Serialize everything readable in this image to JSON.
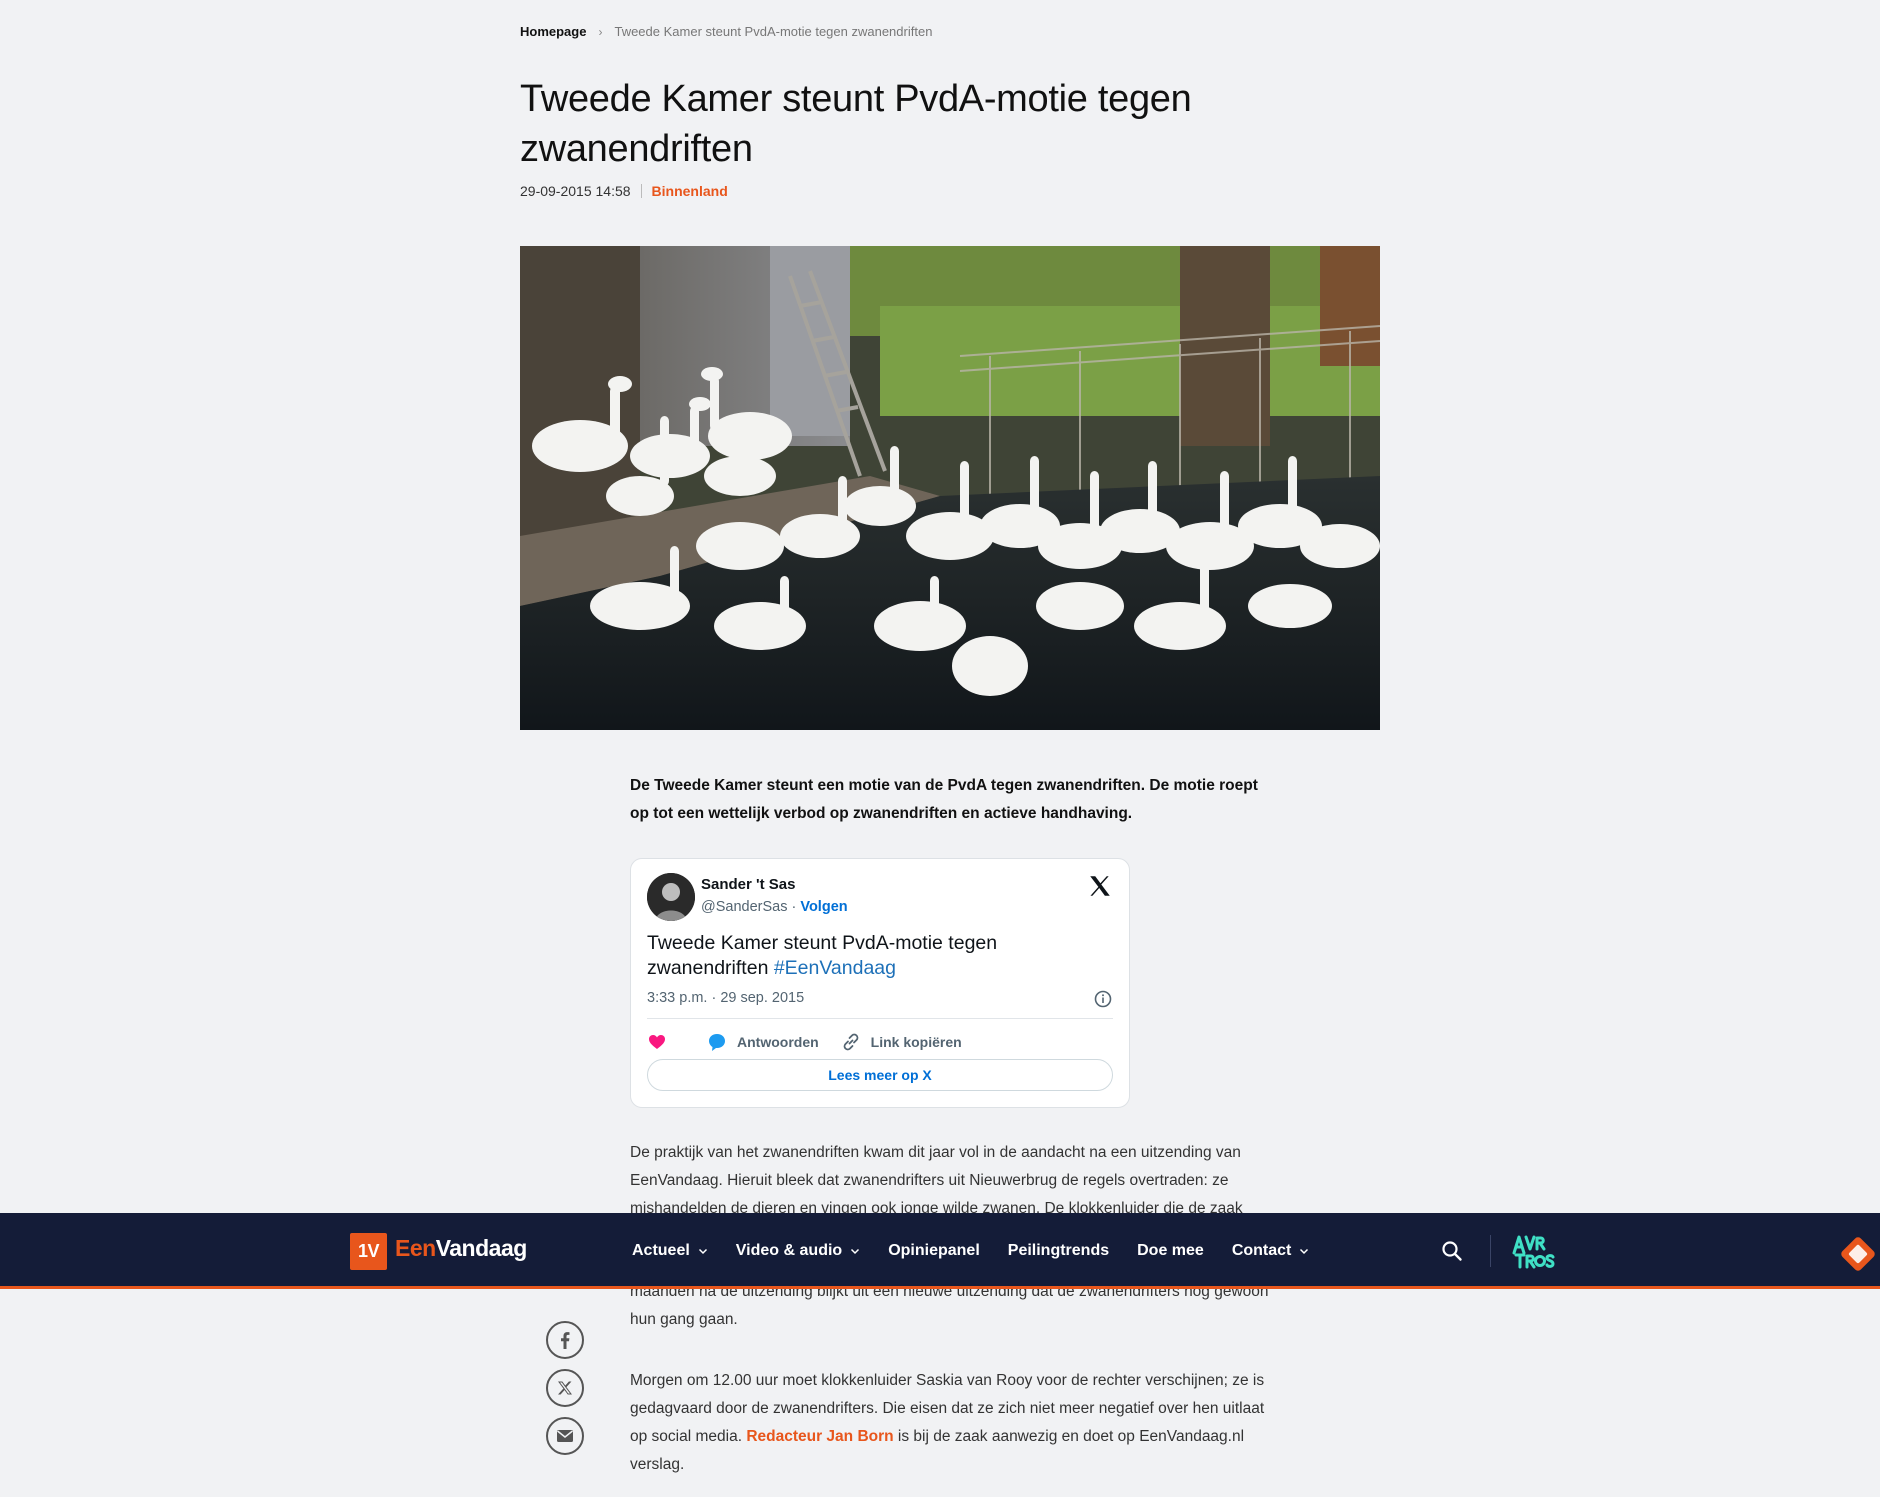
{
  "breadcrumb": {
    "home": "Homepage",
    "separator": "›",
    "current": "Tweede Kamer steunt PvdA-motie tegen zwanendriften"
  },
  "article": {
    "title": "Tweede Kamer steunt PvdA-motie tegen zwanendriften",
    "date": "29-09-2015 14:58",
    "category": "Binnenland",
    "lead": "De Tweede Kamer steunt een motie van de PvdA tegen zwanendriften. De motie roept op tot een wettelijk verbod op zwanendriften en actieve handhaving.",
    "para1": "De praktijk van het zwanendriften kwam dit jaar vol in de aandacht na een uitzending van EenVandaag. Hieruit bleek dat zwanendrifters uit Nieuwerbrug de regels overtraden: ze mishandelden de dieren en vingen ook jonge wilde zwanen. De klokkenluider die de zaak",
    "para1_cont": "maanden na de uitzending blijkt uit een nieuwe uitzending dat de zwanendrifters nog gewoon hun gang gaan.",
    "para2_before": "Morgen om 12.00 uur moet klokkenluider Saskia van Rooy voor de rechter verschijnen; ze is gedagvaard door de zwanendrifters. Die eisen dat ze zich niet meer negatief over hen uitlaat op social media. ",
    "para2_link": "Redacteur Jan Born",
    "para2_after": " is bij de zaak aanwezig en doet op EenVandaag.nl verslag."
  },
  "tweet": {
    "author": "Sander 't Sas",
    "handle": "@SanderSas",
    "dot": " · ",
    "follow": "Volgen",
    "text": "Tweede Kamer steunt PvdA-motie tegen zwanendriften ",
    "hashtag": "#EenVandaag",
    "time": "3:33 p.m. · 29 sep. 2015",
    "reply": "Antwoorden",
    "copy_link": "Link kopiëren",
    "read_more": "Lees meer op X"
  },
  "navbar": {
    "logo_mark": "1V",
    "logo_een": "Een",
    "logo_vandaag": "Vandaag",
    "items": [
      {
        "label": "Actueel",
        "has_dropdown": true
      },
      {
        "label": "Video & audio",
        "has_dropdown": true
      },
      {
        "label": "Opiniepanel",
        "has_dropdown": false
      },
      {
        "label": "Peilingtrends",
        "has_dropdown": false
      },
      {
        "label": "Doe mee",
        "has_dropdown": false
      },
      {
        "label": "Contact",
        "has_dropdown": true
      }
    ]
  },
  "colors": {
    "accent": "#e8561c",
    "nav_bg": "#141c38",
    "link_blue": "#006fd6",
    "heart": "#f91880",
    "reply_blue": "#1d9bf0"
  },
  "icons": [
    "search-icon",
    "chevron-down-icon",
    "facebook-icon",
    "x-icon",
    "email-icon",
    "heart-icon",
    "reply-icon",
    "link-icon",
    "info-icon"
  ]
}
